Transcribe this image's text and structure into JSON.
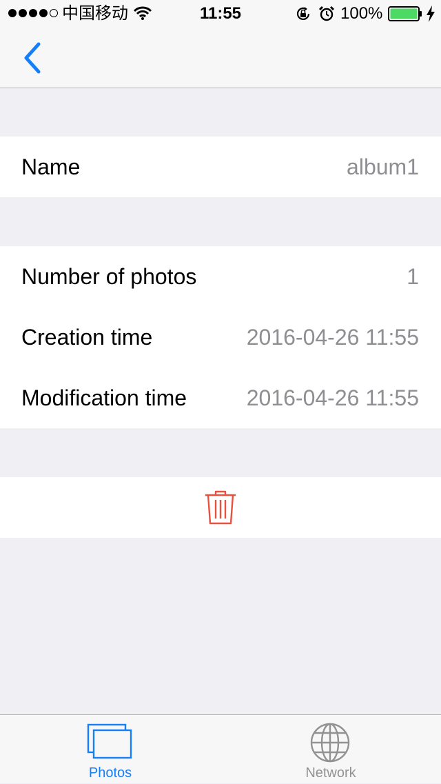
{
  "status_bar": {
    "carrier": "中国移动",
    "time": "11:55",
    "battery_percent": "100%",
    "signal_bars_filled": 4,
    "signal_bars_total": 5,
    "battery_level": 1.0
  },
  "nav": {
    "back_icon": "chevron-left-icon"
  },
  "album_info": {
    "name_label": "Name",
    "name_value": "album1"
  },
  "details": {
    "rows": [
      {
        "label": "Number of photos",
        "value": "1"
      },
      {
        "label": "Creation time",
        "value": "2016-04-26 11:55"
      },
      {
        "label": "Modification time",
        "value": "2016-04-26 11:55"
      }
    ]
  },
  "actions": {
    "delete_icon": "trash-icon"
  },
  "tabbar": {
    "tabs": [
      {
        "label": "Photos",
        "icon": "photos-icon",
        "selected": true
      },
      {
        "label": "Network",
        "icon": "globe-icon",
        "selected": false
      }
    ]
  },
  "colors": {
    "accent": "#157efb",
    "destructive": "#e8513e",
    "secondary_text": "#8e8e93",
    "inactive_tab": "#929292",
    "background": "#efeff4",
    "battery_fill": "#4cd964"
  }
}
